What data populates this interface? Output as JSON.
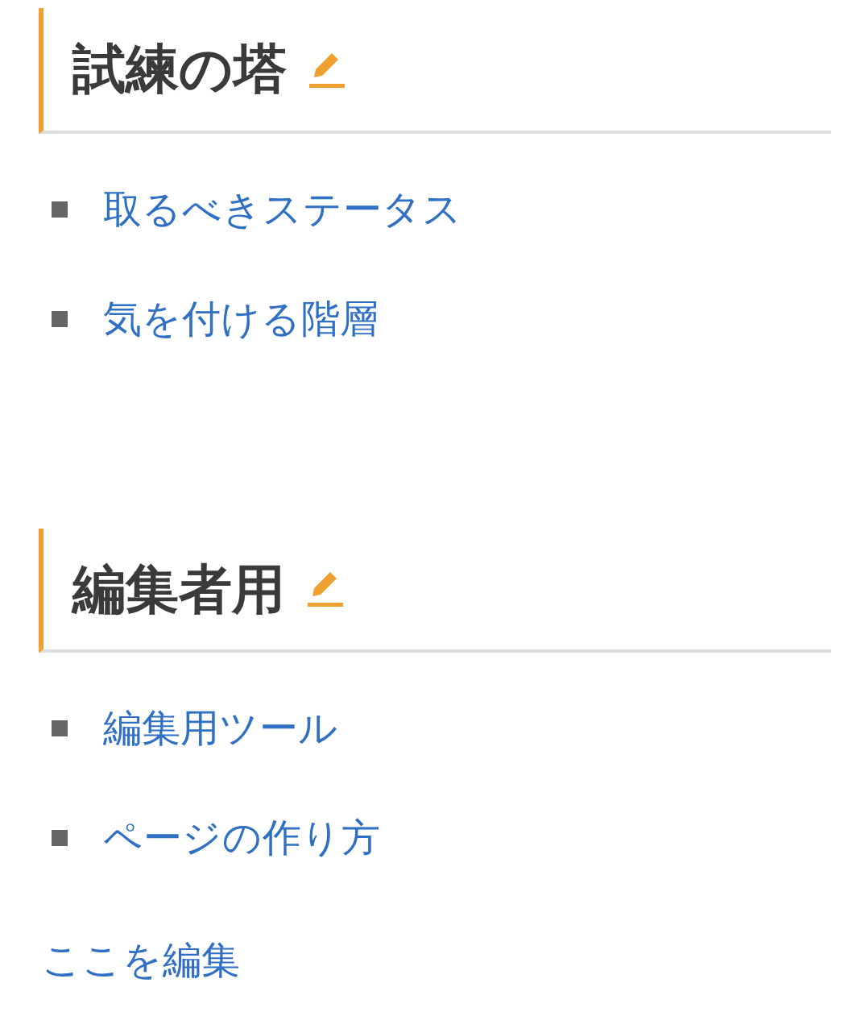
{
  "sections": [
    {
      "title": "試練の塔",
      "links": [
        "取るべきステータス",
        "気を付ける階層"
      ]
    },
    {
      "title": "編集者用",
      "links": [
        "編集用ツール",
        "ページの作り方"
      ]
    }
  ],
  "footer_link": "ここを編集"
}
